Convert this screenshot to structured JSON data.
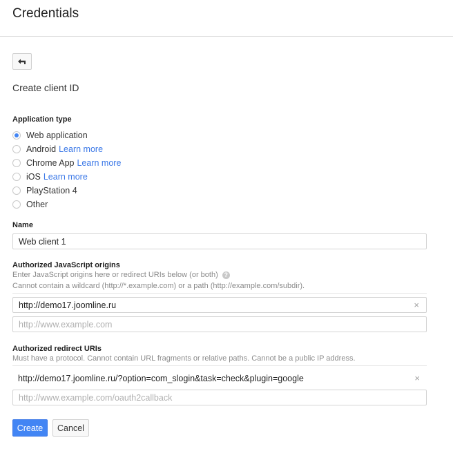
{
  "header": {
    "title": "Credentials"
  },
  "back_button": {
    "icon": "back-arrow-icon",
    "glyph": "↤"
  },
  "subtitle": "Create client ID",
  "application_type": {
    "label": "Application type",
    "options": [
      {
        "label": "Web application",
        "link": "",
        "checked": true
      },
      {
        "label": "Android",
        "link": "Learn more",
        "checked": false
      },
      {
        "label": "Chrome App",
        "link": "Learn more",
        "checked": false
      },
      {
        "label": "iOS",
        "link": "Learn more",
        "checked": false
      },
      {
        "label": "PlayStation 4",
        "link": "",
        "checked": false
      },
      {
        "label": "Other",
        "link": "",
        "checked": false
      }
    ]
  },
  "name": {
    "label": "Name",
    "value": "Web client 1"
  },
  "js_origins": {
    "label": "Authorized JavaScript origins",
    "help1": "Enter JavaScript origins here or redirect URIs below (or both)",
    "help_icon": "?",
    "help2": "Cannot contain a wildcard (http://*.example.com) or a path (http://example.com/subdir).",
    "entries": [
      "http://demo17.joomline.ru"
    ],
    "placeholder": "http://www.example.com",
    "clear_glyph": "×"
  },
  "redirect_uris": {
    "label": "Authorized redirect URIs",
    "help": "Must have a protocol. Cannot contain URL fragments or relative paths. Cannot be a public IP address.",
    "entries": [
      "http://demo17.joomline.ru/?option=com_slogin&task=check&plugin=google"
    ],
    "placeholder": "http://www.example.com/oauth2callback",
    "clear_glyph": "×"
  },
  "actions": {
    "create": "Create",
    "cancel": "Cancel"
  },
  "colors": {
    "primary": "#4285f4",
    "link": "#3b78e7"
  }
}
